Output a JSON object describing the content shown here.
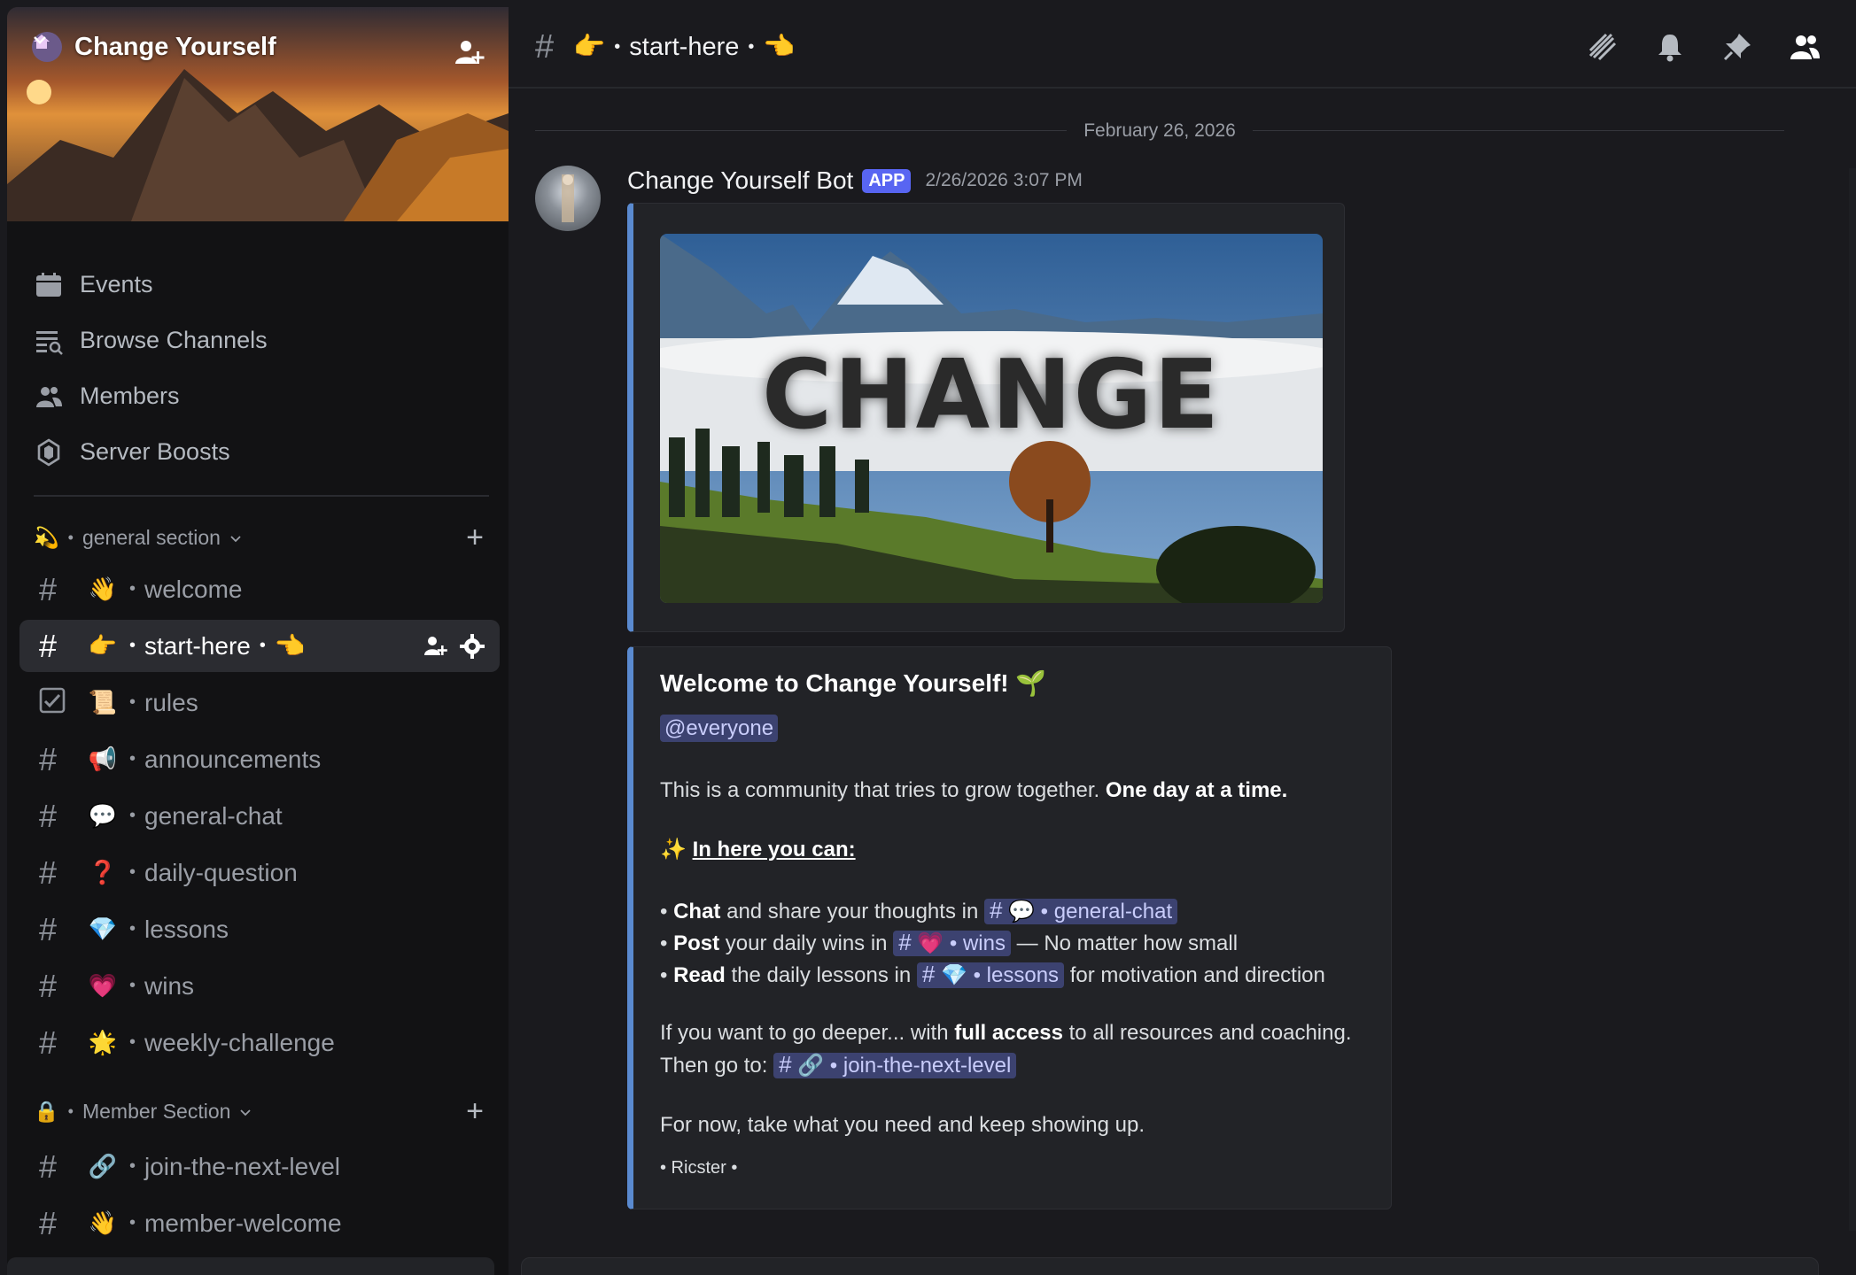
{
  "server": {
    "name": "Change Yourself",
    "nav": [
      "Events",
      "Browse Channels",
      "Members",
      "Server Boosts"
    ]
  },
  "categories": [
    {
      "emoji": "💫",
      "label": "general section"
    },
    {
      "emoji": "🔒",
      "label": "Member Section"
    }
  ],
  "channels": [
    {
      "emoji": "👋",
      "name": "welcome"
    },
    {
      "emoji": "👉",
      "name": "start-here",
      "suffix": "👈"
    },
    {
      "emoji": "📜",
      "name": "rules"
    },
    {
      "emoji": "📢",
      "name": "announcements"
    },
    {
      "emoji": "💬",
      "name": "general-chat"
    },
    {
      "emoji": "❓",
      "name": "daily-question"
    },
    {
      "emoji": "💎",
      "name": "lessons"
    },
    {
      "emoji": "💗",
      "name": "wins"
    },
    {
      "emoji": "🌟",
      "name": "weekly-challenge"
    },
    {
      "emoji": "🔗",
      "name": "join-the-next-level"
    },
    {
      "emoji": "👋",
      "name": "member-welcome"
    }
  ],
  "topbar": {
    "emoji_left": "👉",
    "title": "start-here",
    "emoji_right": "👈"
  },
  "chat": {
    "date_divider": "February 26, 2026",
    "author": "Change Yourself Bot",
    "badge": "APP",
    "timestamp": "2/26/2026 3:07 PM",
    "image_text": "CHANGE"
  },
  "embed": {
    "title": "Welcome to Change Yourself!",
    "title_emoji": "🌱",
    "mention": "@everyone",
    "intro": "This is a community that tries to grow together.",
    "intro_bold": "One day at a time.",
    "heading_emoji": "✨",
    "heading": "In here you can:",
    "line1_bold": "Chat",
    "line1_text": "and share your thoughts in",
    "line1_channel_emoji": "💬",
    "line1_channel": "general-chat",
    "line2_bold": "Post",
    "line2_text": "your daily wins in",
    "line2_channel_emoji": "💗",
    "line2_channel": "wins",
    "line2_tail": "— No matter how small",
    "line3_bold": "Read",
    "line3_text": "the daily lessons in",
    "line3_channel_emoji": "💎",
    "line3_channel": "lessons",
    "line3_tail": "for motivation and direction",
    "deeper_a": "If you want to go deeper... with",
    "deeper_bold": "full access",
    "deeper_b": "to all resources and coaching.",
    "then_go": "Then go to:",
    "then_channel_emoji": "🔗",
    "then_channel": "join-the-next-level",
    "closing": "For now, take what you need and keep showing up.",
    "signature": "• Ricster •"
  },
  "colors": {
    "accent": "#5865f2",
    "embed_border": "#5a8ad0",
    "mention_bg": "#3c4270"
  }
}
